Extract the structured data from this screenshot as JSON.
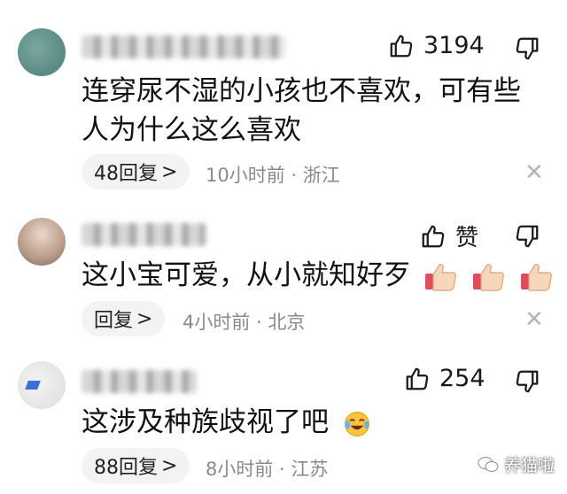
{
  "comments": [
    {
      "like_count": "3194",
      "text_lines": [
        "连穿尿不湿的小孩也不喜欢，可有些",
        "人为什么这么喜欢"
      ],
      "reply_label": "48回复",
      "reply_chevron": ">",
      "meta": "10小时前 · 浙江"
    },
    {
      "like_count": "赞",
      "text_lines": [
        "这小宝可爱，从小就知好歹"
      ],
      "reply_label": "回复",
      "reply_chevron": ">",
      "meta": "4小时前 · 北京"
    },
    {
      "like_count": "254",
      "text_lines": [
        "这涉及种族歧视了吧"
      ],
      "reply_label": "88回复",
      "reply_chevron": ">",
      "meta": "8小时前 · 江苏"
    }
  ],
  "close_glyph": "✕",
  "watermark": {
    "text": "养猫啦"
  },
  "colors": {
    "meta_gray": "#8a8a8a",
    "pill_bg": "#f3f3f3",
    "avatar_teal": "#5f8f8a"
  },
  "icons": [
    "thumbs-up-icon",
    "thumbs-down-icon",
    "close-icon",
    "thumbs-up-emoji",
    "laughing-crying-emoji",
    "wechat-icon"
  ]
}
